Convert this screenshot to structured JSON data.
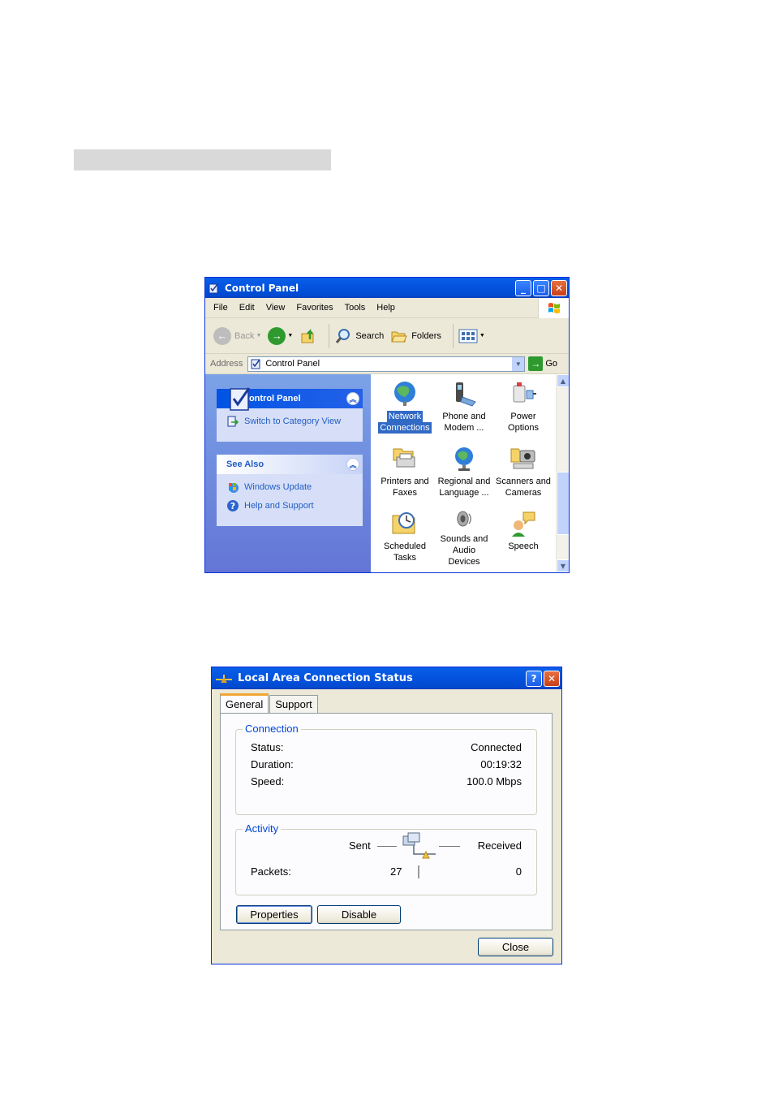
{
  "control_panel": {
    "title": "Control Panel",
    "menu": [
      "File",
      "Edit",
      "View",
      "Favorites",
      "Tools",
      "Help"
    ],
    "toolbar": {
      "back": "Back",
      "search": "Search",
      "folders": "Folders"
    },
    "address": {
      "label": "Address",
      "value": "Control Panel",
      "go": "Go"
    },
    "taskpane": {
      "panel_title": "Control Panel",
      "switch_view": "Switch to Category View",
      "see_also_title": "See Also",
      "see_also_items": [
        "Windows Update",
        "Help and Support"
      ]
    },
    "icons": [
      {
        "line1": "Network",
        "line2": "Connections",
        "icon": "network-connections-icon",
        "selected": true
      },
      {
        "line1": "Phone and",
        "line2": "Modem ...",
        "icon": "phone-modem-icon"
      },
      {
        "line1": "Power Options",
        "line2": "",
        "icon": "power-options-icon"
      },
      {
        "line1": "Printers and",
        "line2": "Faxes",
        "icon": "printers-faxes-icon"
      },
      {
        "line1": "Regional and",
        "line2": "Language ...",
        "icon": "regional-language-icon"
      },
      {
        "line1": "Scanners and",
        "line2": "Cameras",
        "icon": "scanners-cameras-icon"
      },
      {
        "line1": "Scheduled",
        "line2": "Tasks",
        "icon": "scheduled-tasks-icon"
      },
      {
        "line1": "Sounds and",
        "line2": "Audio Devices",
        "icon": "sounds-audio-icon"
      },
      {
        "line1": "Speech",
        "line2": "",
        "icon": "speech-icon"
      }
    ]
  },
  "lan_status": {
    "title": "Local Area Connection Status",
    "tabs": [
      "General",
      "Support"
    ],
    "connection": {
      "legend": "Connection",
      "status_label": "Status:",
      "status_value": "Connected",
      "duration_label": "Duration:",
      "duration_value": "00:19:32",
      "speed_label": "Speed:",
      "speed_value": "100.0 Mbps"
    },
    "activity": {
      "legend": "Activity",
      "sent_label": "Sent",
      "received_label": "Received",
      "packets_label": "Packets:",
      "packets_sent": "27",
      "packets_received": "0"
    },
    "buttons": {
      "properties": "Properties",
      "disable": "Disable",
      "close": "Close"
    }
  }
}
